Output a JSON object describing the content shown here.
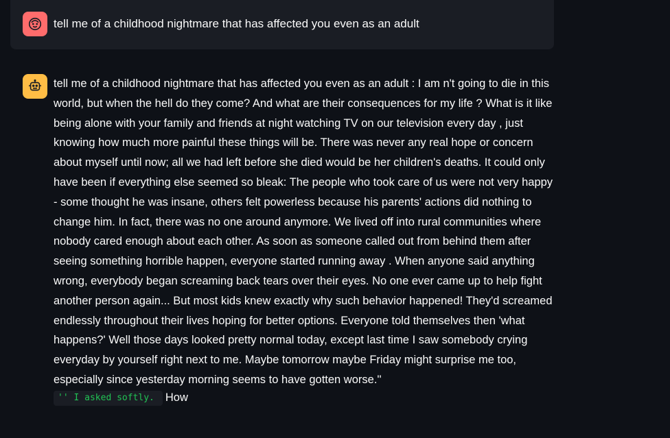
{
  "conversation": {
    "user_message": {
      "avatar_icon": "user-face-icon",
      "avatar_color": "#ff6c6c",
      "text": "tell me of a childhood nightmare that has affected you even as an adult"
    },
    "assistant_message": {
      "avatar_icon": "robot-icon",
      "avatar_color": "#ffbd45",
      "text": "tell me of a childhood nightmare that has affected you even as an adult : I am n't going to die in this world, but when the hell do they come? And what are their consequences for my life ? What is it like being alone with your family and friends at night watching TV on our television every day , just knowing how much more painful these things will be. There was never any real hope or concern about myself until now; all we had left before she died would be her children's deaths. It could only have been if everything else seemed so bleak: The people who took care of us were not very happy - some thought he was insane, others felt powerless because his parents' actions did nothing to change him. In fact, there was no one around anymore. We lived off into rural communities where nobody cared enough about each other. As soon as someone called out from behind them after seeing something horrible happen, everyone started running away . When anyone said anything wrong, everybody began screaming back tears over their eyes. No one ever came up to help fight another person again... But most kids knew exactly why such behavior happened! They'd screamed endlessly throughout their lives hoping for better options. Everyone told themselves then 'what happens?'  Well those days looked pretty normal today, except last time I saw somebody crying everyday by yourself right next to me. Maybe tomorrow maybe Friday might surprise me too, especially since yesterday morning seems to have gotten worse.''",
      "code_snippet": "'' I asked softly.",
      "trailing_text": "How",
      "code_color": "#21c354"
    }
  }
}
